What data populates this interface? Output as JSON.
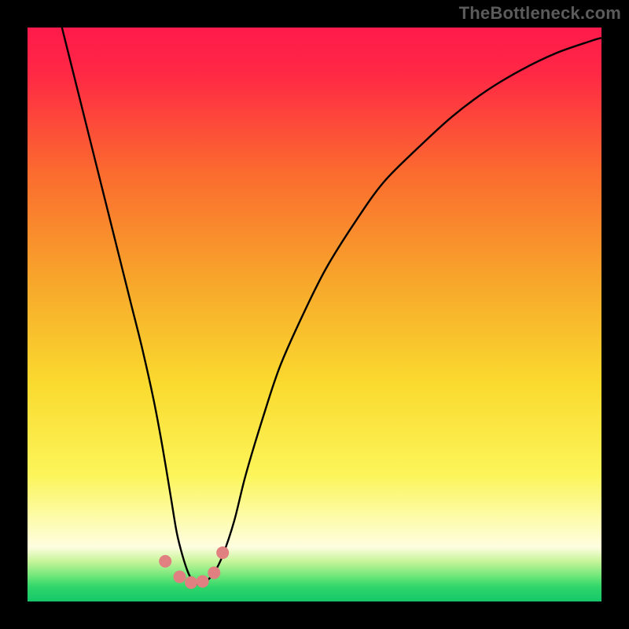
{
  "watermark": "TheBottleneck.com",
  "chart_data": {
    "type": "line",
    "title": "",
    "xlabel": "",
    "ylabel": "",
    "xlim": [
      0,
      100
    ],
    "ylim": [
      0,
      100
    ],
    "background_gradient": {
      "stops": [
        {
          "offset": 0,
          "color": "#ff1a4b"
        },
        {
          "offset": 0.08,
          "color": "#ff2845"
        },
        {
          "offset": 0.25,
          "color": "#fb6a2f"
        },
        {
          "offset": 0.45,
          "color": "#f7a92b"
        },
        {
          "offset": 0.62,
          "color": "#fada2e"
        },
        {
          "offset": 0.78,
          "color": "#fcf55a"
        },
        {
          "offset": 0.86,
          "color": "#fdfcb0"
        },
        {
          "offset": 0.905,
          "color": "#fefde0"
        },
        {
          "offset": 0.93,
          "color": "#c7f59a"
        },
        {
          "offset": 0.955,
          "color": "#71e77a"
        },
        {
          "offset": 0.975,
          "color": "#2fd66a"
        },
        {
          "offset": 1.0,
          "color": "#15c668"
        }
      ]
    },
    "series": [
      {
        "name": "bottleneck-curve",
        "color": "#000000",
        "x": [
          6,
          8,
          10,
          12,
          14,
          16,
          18,
          20,
          22,
          23.5,
          25,
          26,
          27,
          28,
          29,
          30,
          31,
          32.5,
          34,
          36,
          38,
          41,
          44,
          48,
          52,
          57,
          62,
          68,
          74,
          80,
          86,
          92,
          98,
          100
        ],
        "values": [
          100,
          92,
          84,
          76,
          68,
          60,
          52,
          44,
          35,
          27,
          18,
          12,
          8,
          5,
          3.3,
          3,
          3.4,
          5,
          8,
          14,
          22,
          32,
          41,
          50,
          58,
          66,
          73,
          79,
          84.5,
          89,
          92.6,
          95.5,
          97.6,
          98.2
        ]
      }
    ],
    "markers": {
      "name": "trough-markers",
      "color": "#e08080",
      "radius_px": 8,
      "points": [
        {
          "x": 24.0,
          "y": 7.0
        },
        {
          "x": 26.5,
          "y": 4.3
        },
        {
          "x": 28.5,
          "y": 3.3
        },
        {
          "x": 30.5,
          "y": 3.5
        },
        {
          "x": 32.5,
          "y": 5.0
        },
        {
          "x": 34.0,
          "y": 8.5
        }
      ]
    }
  }
}
